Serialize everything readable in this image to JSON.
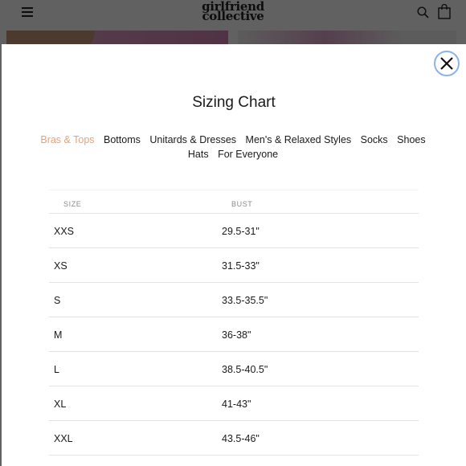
{
  "site": {
    "logo_line1": "girlfriend",
    "logo_line2": "collective"
  },
  "icons": {
    "menu": "hamburger-menu-icon",
    "search": "search-icon",
    "bag": "shopping-bag-icon",
    "close": "close-icon"
  },
  "modal": {
    "title": "Sizing Chart",
    "tabs": [
      {
        "label": "Bras & Tops",
        "active": true
      },
      {
        "label": "Bottoms",
        "active": false
      },
      {
        "label": "Unitards & Dresses",
        "active": false
      },
      {
        "label": "Men's & Relaxed Styles",
        "active": false
      },
      {
        "label": "Socks",
        "active": false
      },
      {
        "label": "Shoes",
        "active": false
      },
      {
        "label": "Hats",
        "active": false
      },
      {
        "label": "For Everyone",
        "active": false
      }
    ],
    "table": {
      "columns": [
        "SIZE",
        "BUST"
      ],
      "rows": [
        [
          "XXS",
          "29.5-31\""
        ],
        [
          "XS",
          "31.5-33\""
        ],
        [
          "S",
          "33.5-35.5\""
        ],
        [
          "M",
          "36-38\""
        ],
        [
          "L",
          "38.5-40.5\""
        ],
        [
          "XL",
          "41-43\""
        ],
        [
          "XXL",
          "43.5-46\""
        ]
      ]
    }
  },
  "colors": {
    "active_tab": "#e3a27c",
    "overlay": "rgba(0,0,0,0.62)",
    "close_ring": "#8ab4e8"
  }
}
